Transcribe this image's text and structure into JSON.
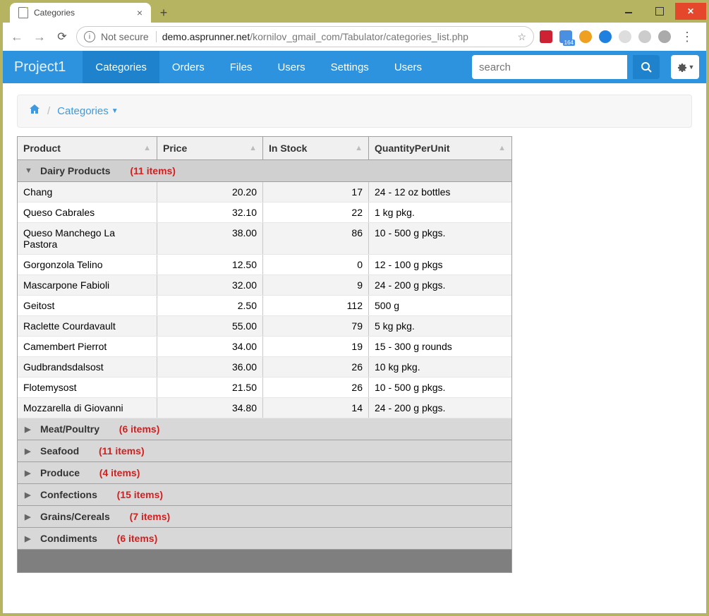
{
  "browser": {
    "tab_title": "Categories",
    "newtab": "+",
    "not_secure": "Not secure",
    "url_domain": "demo.asprunner.net",
    "url_path": "/kornilov_gmail_com/Tabulator/categories_list.php"
  },
  "navbar": {
    "brand": "Project1",
    "items": [
      "Categories",
      "Orders",
      "Files",
      "Users",
      "Settings",
      "Users"
    ],
    "active_index": 0,
    "search_placeholder": "search"
  },
  "breadcrumb": {
    "current": "Categories"
  },
  "table": {
    "columns": [
      "Product",
      "Price",
      "In Stock",
      "QuantityPerUnit"
    ],
    "groups": [
      {
        "name": "Dairy Products",
        "count_label": "(11 items)",
        "expanded": true,
        "rows": [
          {
            "product": "Chang",
            "price": "20.20",
            "stock": "17",
            "qpu": "24 - 12 oz bottles"
          },
          {
            "product": "Queso Cabrales",
            "price": "32.10",
            "stock": "22",
            "qpu": "1 kg pkg."
          },
          {
            "product": "Queso Manchego La Pastora",
            "price": "38.00",
            "stock": "86",
            "qpu": "10 - 500 g pkgs."
          },
          {
            "product": "Gorgonzola Telino",
            "price": "12.50",
            "stock": "0",
            "qpu": "12 - 100 g pkgs"
          },
          {
            "product": "Mascarpone Fabioli",
            "price": "32.00",
            "stock": "9",
            "qpu": "24 - 200 g pkgs."
          },
          {
            "product": "Geitost",
            "price": "2.50",
            "stock": "112",
            "qpu": "500 g"
          },
          {
            "product": "Raclette Courdavault",
            "price": "55.00",
            "stock": "79",
            "qpu": "5 kg pkg."
          },
          {
            "product": "Camembert Pierrot",
            "price": "34.00",
            "stock": "19",
            "qpu": "15 - 300 g rounds"
          },
          {
            "product": "Gudbrandsdalsost",
            "price": "36.00",
            "stock": "26",
            "qpu": "10 kg pkg."
          },
          {
            "product": "Flotemysost",
            "price": "21.50",
            "stock": "26",
            "qpu": "10 - 500 g pkgs."
          },
          {
            "product": "Mozzarella di Giovanni",
            "price": "34.80",
            "stock": "14",
            "qpu": "24 - 200 g pkgs."
          }
        ]
      },
      {
        "name": "Meat/Poultry",
        "count_label": "(6 items)",
        "expanded": false,
        "rows": []
      },
      {
        "name": "Seafood",
        "count_label": "(11 items)",
        "expanded": false,
        "rows": []
      },
      {
        "name": "Produce",
        "count_label": "(4 items)",
        "expanded": false,
        "rows": []
      },
      {
        "name": "Confections",
        "count_label": "(15 items)",
        "expanded": false,
        "rows": []
      },
      {
        "name": "Grains/Cereals",
        "count_label": "(7 items)",
        "expanded": false,
        "rows": []
      },
      {
        "name": "Condiments",
        "count_label": "(6 items)",
        "expanded": false,
        "rows": []
      }
    ]
  }
}
